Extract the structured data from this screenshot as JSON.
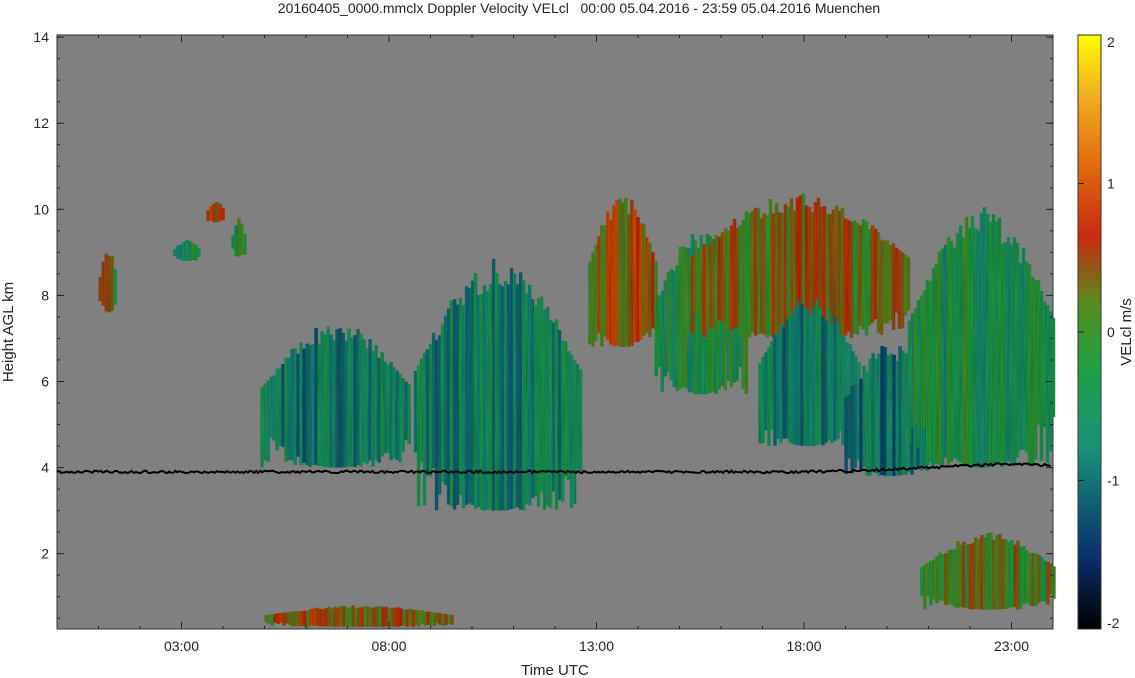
{
  "chart_data": {
    "type": "heatmap",
    "title": "20160405_0000.mmclx Doppler Velocity VELcl   00:00 05.04.2016 - 23:59 05.04.2016 Muenchen",
    "xlabel": "Time UTC",
    "ylabel": "Height AGL km",
    "x_ticks": [
      "03:00",
      "08:00",
      "13:00",
      "18:00",
      "23:00"
    ],
    "x_tick_values": [
      3,
      8,
      13,
      18,
      23
    ],
    "xlim": [
      0,
      24
    ],
    "y_ticks": [
      "2",
      "4",
      "6",
      "8",
      "10",
      "12",
      "14"
    ],
    "y_tick_values": [
      2,
      4,
      6,
      8,
      10,
      12,
      14
    ],
    "ylim": [
      0.25,
      14.05
    ],
    "colorbar": {
      "label": "VELcl m/s",
      "range": [
        -2,
        2
      ],
      "ticks": [
        "2",
        "1",
        "0",
        "-1",
        "-2"
      ],
      "tick_values": [
        2,
        1,
        0,
        -1,
        -2
      ],
      "colors": [
        "#000000",
        "#0b2e6b",
        "#1a8f7a",
        "#22a040",
        "#5a8a20",
        "#c82a10",
        "#e26a10",
        "#f0b020",
        "#ffff00"
      ]
    },
    "background_color": "#808080",
    "line_series": {
      "values_km": [
        3.9,
        3.9,
        3.9,
        3.9,
        3.9,
        3.9,
        3.9,
        3.9,
        3.9,
        3.9,
        3.9,
        3.9,
        3.9,
        3.9,
        3.9,
        3.9,
        3.9,
        3.9,
        3.9,
        3.92,
        3.95,
        4.0,
        4.05,
        4.08,
        4.05
      ],
      "x_hours": [
        0,
        1,
        2,
        3,
        4,
        5,
        6,
        7,
        8,
        9,
        10,
        11,
        12,
        13,
        14,
        15,
        16,
        17,
        18,
        19,
        20,
        21,
        22,
        23,
        24
      ]
    },
    "echo_regions": [
      {
        "t0": 1.0,
        "t1": 1.4,
        "h0": 7.6,
        "h1": 9.1,
        "vel": 0.2
      },
      {
        "t0": 2.8,
        "t1": 3.4,
        "h0": 8.8,
        "h1": 9.3,
        "vel": -0.4
      },
      {
        "t0": 3.6,
        "t1": 4.0,
        "h0": 9.7,
        "h1": 10.2,
        "vel": 0.5
      },
      {
        "t0": 4.2,
        "t1": 4.5,
        "h0": 8.9,
        "h1": 9.8,
        "vel": -0.3
      },
      {
        "t0": 4.9,
        "t1": 8.5,
        "h0": 4.0,
        "h1": 7.4,
        "vel": -0.8
      },
      {
        "t0": 8.6,
        "t1": 12.6,
        "h0": 3.0,
        "h1": 8.9,
        "vel": -0.7
      },
      {
        "t0": 12.8,
        "t1": 14.4,
        "h0": 6.8,
        "h1": 10.4,
        "vel": 0.5
      },
      {
        "t0": 14.4,
        "t1": 16.6,
        "h0": 5.7,
        "h1": 9.6,
        "vel": -0.3
      },
      {
        "t0": 15.2,
        "t1": 20.5,
        "h0": 7.0,
        "h1": 10.4,
        "vel": 0.3
      },
      {
        "t0": 16.9,
        "t1": 19.3,
        "h0": 4.5,
        "h1": 8.0,
        "vel": -0.8
      },
      {
        "t0": 18.9,
        "t1": 21.2,
        "h0": 3.8,
        "h1": 6.9,
        "vel": -0.9
      },
      {
        "t0": 20.5,
        "t1": 24.0,
        "h0": 4.0,
        "h1": 10.2,
        "vel": -0.4
      },
      {
        "t0": 20.8,
        "t1": 24.0,
        "h0": 0.7,
        "h1": 2.5,
        "vel": 0.1
      },
      {
        "t0": 5.0,
        "t1": 9.5,
        "h0": 0.3,
        "h1": 0.8,
        "vel": 0.4
      }
    ]
  }
}
